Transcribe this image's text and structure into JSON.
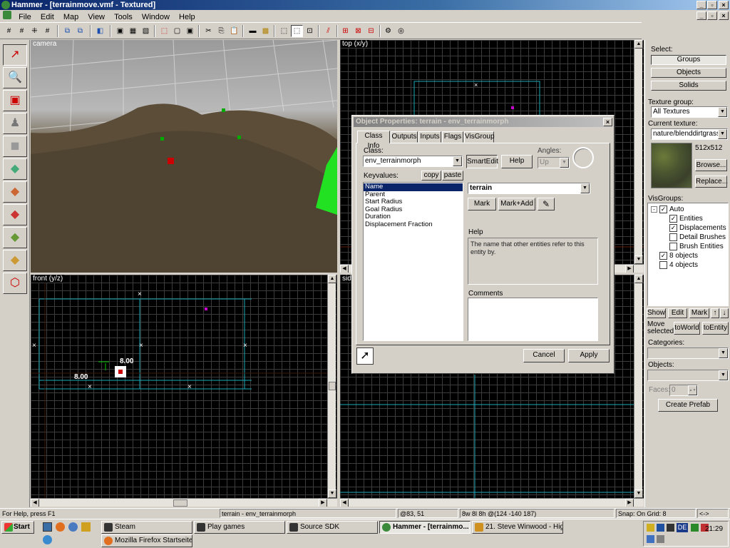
{
  "app": {
    "title": "Hammer - [terrainmove.vmf - Textured]"
  },
  "menu": [
    "File",
    "Edit",
    "Map",
    "View",
    "Tools",
    "Window",
    "Help"
  ],
  "views": {
    "camera": "camera",
    "top": "top (x/y)",
    "front": "front (y/z)",
    "side": "sid",
    "dim_vertical": "8.00",
    "dim_horizontal": "8.00"
  },
  "right_panel": {
    "select_label": "Select:",
    "groups": "Groups",
    "objects": "Objects",
    "solids": "Solids",
    "texture_group_label": "Texture group:",
    "texture_group_value": "All Textures",
    "current_texture_label": "Current texture:",
    "current_texture_value": "nature/blenddirtgrass00",
    "texture_size": "512x512",
    "browse": "Browse...",
    "replace": "Replace...",
    "visgroups_label": "VisGroups:",
    "visgroups": [
      {
        "label": "Auto",
        "checked": true,
        "indent": 0,
        "expander": "-"
      },
      {
        "label": "Entities",
        "checked": true,
        "indent": 1
      },
      {
        "label": "Displacements",
        "checked": true,
        "indent": 1
      },
      {
        "label": "Detail Brushes",
        "checked": false,
        "indent": 1
      },
      {
        "label": "Brush Entities",
        "checked": false,
        "indent": 1
      },
      {
        "label": "8 objects",
        "checked": true,
        "indent": 0
      },
      {
        "label": "4 objects",
        "checked": false,
        "indent": 0
      }
    ],
    "show": "Show",
    "edit": "Edit",
    "mark": "Mark",
    "up": "↑",
    "down": "↓",
    "move_selected": "Move selected:",
    "to_world": "toWorld",
    "to_entity": "toEntity",
    "categories_label": "Categories:",
    "objects_label": "Objects:",
    "faces_label": "Faces:",
    "faces_value": "0",
    "create_prefab": "Create Prefab"
  },
  "dialog": {
    "title": "Object Properties: terrain - env_terrainmorph",
    "tabs": [
      "Class Info",
      "Outputs",
      "Inputs",
      "Flags",
      "VisGroup"
    ],
    "class_label": "Class:",
    "class_value": "env_terrainmorph",
    "smartedit": "SmartEdit",
    "help": "Help",
    "angles_label": "Angles:",
    "angles_value": "Up",
    "keyvalues_label": "Keyvalues:",
    "copy": "copy",
    "paste": "paste",
    "keyvalues": [
      "Name",
      "Parent",
      "Start Radius",
      "Goal Radius",
      "Duration",
      "Displacement Fraction"
    ],
    "value": "terrain",
    "mark": "Mark",
    "mark_add": "Mark+Add",
    "help_label": "Help",
    "help_text": "The name that other entities refer to this entity by.",
    "comments_label": "Comments",
    "cancel": "Cancel",
    "apply": "Apply"
  },
  "status": {
    "help": "For Help, press F1",
    "selection": "terrain - env_terrainmorph",
    "coords": "@83, 51",
    "size": "8w 8l 8h @(124 -140 187)",
    "snap": "Snap: On Grid: 8",
    "arrows": "<->"
  },
  "taskbar": {
    "start": "Start",
    "tasks": [
      "Steam",
      "Play games",
      "Source SDK",
      "Hammer - [terrainmo...",
      "21. Steve Winwood - Hig...",
      "Mozilla Firefox Startseite ..."
    ],
    "clock": "21:29",
    "tray_lang": "DE"
  }
}
